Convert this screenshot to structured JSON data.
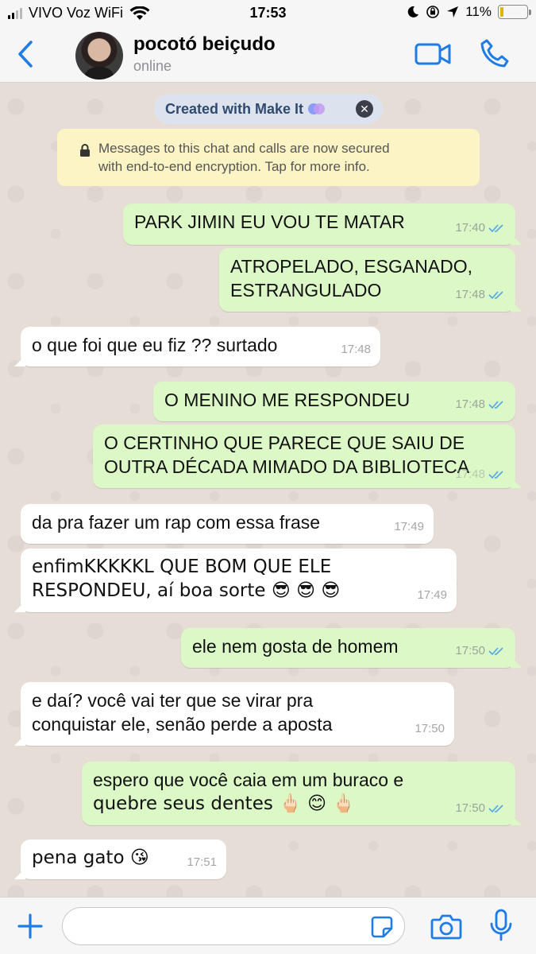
{
  "status_bar": {
    "carrier": "VIVO Voz WiFi",
    "time": "17:53",
    "battery": "11%",
    "battery_level": 0.11
  },
  "header": {
    "contact_name": "pocotó beiçudo",
    "contact_status": "online"
  },
  "banner": {
    "text": "Created with Make It"
  },
  "encryption_notice": {
    "line1": "Messages to this chat and calls are now secured",
    "line2": "with end-to-end encryption. Tap for more info."
  },
  "messages": [
    {
      "direction": "out",
      "lines": [
        "PARK JIMIN EU VOU TE MATAR"
      ],
      "time": "17:40",
      "read": true
    },
    {
      "direction": "out",
      "lines": [
        "ATROPELADO, ESGANADO,",
        "ESTRANGULADO"
      ],
      "time": "17:48",
      "read": true
    },
    {
      "direction": "in",
      "lines": [
        "o que foi que eu fiz ?? surtado"
      ],
      "time": "17:48"
    },
    {
      "direction": "out",
      "lines": [
        "O MENINO ME RESPONDEU"
      ],
      "time": "17:48",
      "read": true
    },
    {
      "direction": "out",
      "lines": [
        "O CERTINHO QUE PARECE QUE SAIU DE",
        "OUTRA DÉCADA MIMADO DA BIBLIOTECA"
      ],
      "time": "17:48",
      "read": true
    },
    {
      "direction": "in",
      "lines": [
        "da pra fazer um rap com essa frase"
      ],
      "time": "17:49"
    },
    {
      "direction": "in",
      "lines": [
        "enfimKKKKKL QUE BOM QUE ELE",
        "RESPONDEU, aí boa sorte 😎 😎 😎"
      ],
      "time": "17:49"
    },
    {
      "direction": "out",
      "lines": [
        "ele nem gosta de homem"
      ],
      "time": "17:50",
      "read": true
    },
    {
      "direction": "in",
      "lines": [
        "e daí? você vai ter que se virar pra",
        "conquistar ele, senão perde a aposta"
      ],
      "time": "17:50"
    },
    {
      "direction": "out",
      "lines": [
        "espero que você caia em um buraco e",
        "quebre seus dentes 🖕🏻 😊 🖕🏻"
      ],
      "time": "17:50",
      "read": true
    },
    {
      "direction": "in",
      "lines": [
        "pena gato 😘"
      ],
      "time": "17:51"
    }
  ],
  "input": {
    "value": "",
    "placeholder": ""
  },
  "colors": {
    "accent": "#1f7ce6",
    "outgoing_bubble": "#dcf8c6",
    "incoming_bubble": "#ffffff",
    "read_ticks": "#4fa6e8"
  }
}
